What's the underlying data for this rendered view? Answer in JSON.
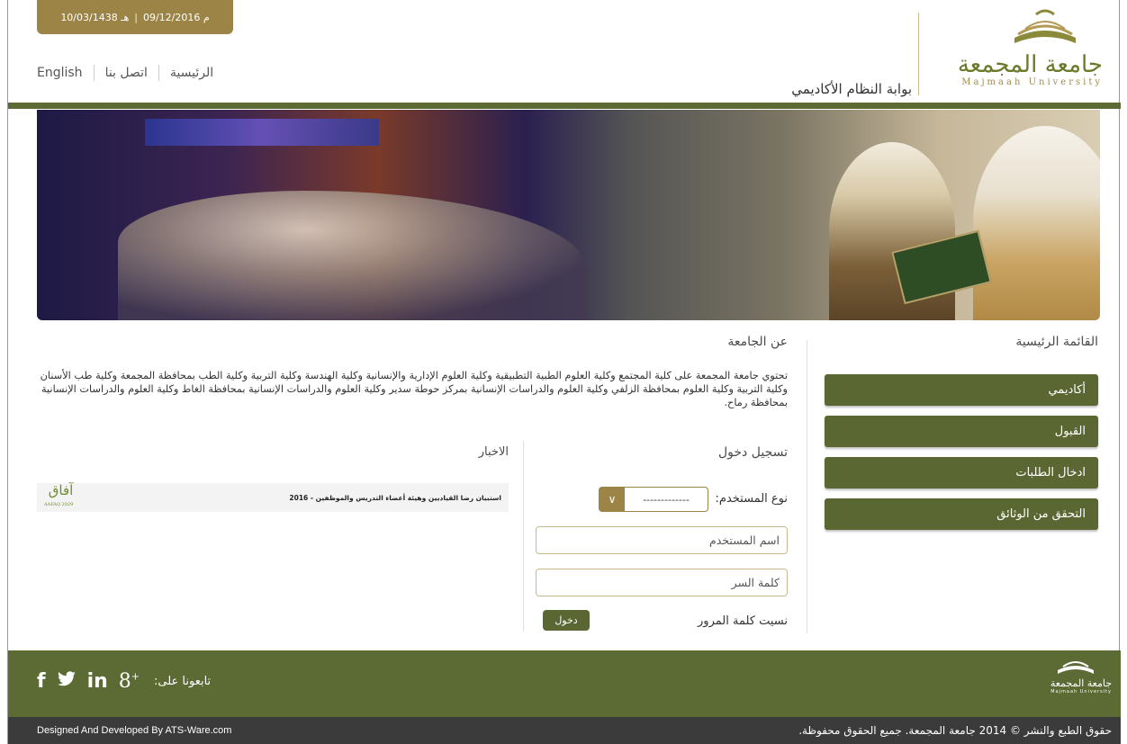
{
  "header": {
    "hijri_date": "10/03/1438 هـ",
    "gregorian_date": "09/12/2016 م",
    "nav": [
      "English",
      "اتصل بنا",
      "الرئيسية"
    ],
    "portal_title": "بوابة النظام الأكاديمي",
    "logo_ar": "جامعة المجمعة",
    "logo_en": "Majmaah University"
  },
  "menu": {
    "title": "القائمة الرئيسية",
    "items": [
      "أكاديمي",
      "القبول",
      "ادخال الطلبات",
      "التحقق من الوثائق"
    ]
  },
  "about": {
    "title": "عن الجامعة",
    "text": "تحتوي جامعة المجمعة على كلية المجتمع وكلية العلوم الطبية التطبيقية وكلية العلوم الإدارية والإنسانية وكلية الهندسة وكلية التربية وكلية الطب بمحافظة المجمعة وكلية طب الأسنان وكلية التربية وكلية العلوم بمحافظة الزلفي وكلية العلوم والدراسات الإنسانية بمركز حوطة سدير وكلية العلوم والدراسات الإنسانية بمحافظة الغاط وكلية العلوم والدراسات الإنسانية بمحافظة رماح."
  },
  "login": {
    "title": "تسجيل دخول",
    "user_type_label": "نوع المستخدم:",
    "user_type_value": "-------------",
    "username_placeholder": "اسم المستخدم",
    "password_placeholder": "كلمة السر",
    "forgot": "نسيت كلمة المرور",
    "submit": "دخول"
  },
  "news": {
    "title": "الاخبار",
    "items": [
      {
        "text": "استبيان رضا القياديين وهيئة أعضاء التدريس والموظفين - 2016",
        "badge": "آفاق",
        "badge_sub": "AAFAQ 2029"
      }
    ]
  },
  "footer": {
    "follow_label": "تابعونا على:",
    "social": [
      "f",
      "twitter",
      "in",
      "g+"
    ],
    "logo_ar": "جامعة المجمعة",
    "logo_en": "Majmaah University",
    "copyright": "حقوق الطبع والنشر © 2014 جامعة المجمعة. جميع الحقوق محفوظة.",
    "developer": "Designed And Developed By ATS-Ware.com"
  },
  "colors": {
    "olive": "#5b6733",
    "gold": "#9c8446",
    "dark_footer": "#3b3b3b"
  }
}
